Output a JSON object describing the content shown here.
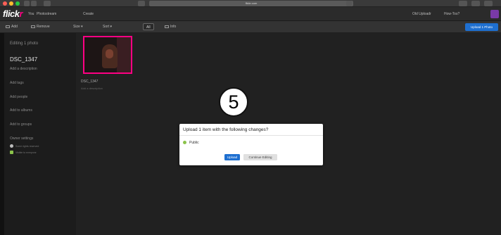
{
  "browser": {
    "url": "flickr.com"
  },
  "topnav": {
    "logo_text": "flick",
    "logo_accent": "r",
    "links": [
      "You",
      "Photostream",
      "Create"
    ],
    "right_links": [
      "Old Uploadr",
      "How-Tos?"
    ]
  },
  "toolbar": {
    "add_label": "Add",
    "remove_label": "Remove",
    "size_label": "Size",
    "sort_label": "Sort",
    "all_label": "All",
    "info_label": "Info",
    "upload_label": "Upload 1 Photo"
  },
  "sidebar": {
    "editing_label": "Editing 1 photo",
    "photo_title": "DSC_1347",
    "add_description": "Add a description",
    "add_tags": "Add tags",
    "add_people": "Add people",
    "add_to_albums": "Add to albums",
    "add_to_groups": "Add to groups",
    "owner_settings": "Owner settings",
    "setting_1": "Some rights reserved",
    "setting_2": "Visible to everyone"
  },
  "main": {
    "photo_name": "DSC_1347",
    "photo_description": "Add a description"
  },
  "step_marker": "5",
  "modal": {
    "title": "Upload 1 item with the following changes?",
    "public_label": "Public",
    "upload_button": "Upload",
    "continue_button": "Continue Editing"
  },
  "colors": {
    "accent_blue": "#1e6fd0",
    "flickr_pink": "#ff0084",
    "public_green": "#8bc34a"
  }
}
